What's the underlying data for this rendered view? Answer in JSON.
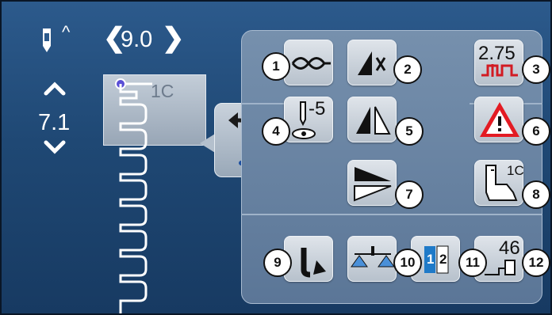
{
  "status": {
    "needle_caret": "^",
    "width_prev": "❮",
    "width_value": "9.0",
    "width_next": "❯",
    "length_value": "7.1",
    "stitch_label": "1C"
  },
  "buttons": {
    "length_readout": "2.75",
    "needle_stop_value": "-5",
    "foot_label": "1C",
    "presser_value": "46",
    "sequence_1": "1",
    "sequence_2": "2"
  },
  "callouts": [
    "1",
    "2",
    "3",
    "4",
    "5",
    "6",
    "7",
    "8",
    "9",
    "10",
    "11",
    "12"
  ],
  "icons": {
    "needle": "needle-position-icon",
    "info": "info-icon",
    "warning": "warning-icon"
  },
  "colors": {
    "accent": "#1f7ac8",
    "warning": "#e31b23",
    "background": "#1f4874"
  }
}
